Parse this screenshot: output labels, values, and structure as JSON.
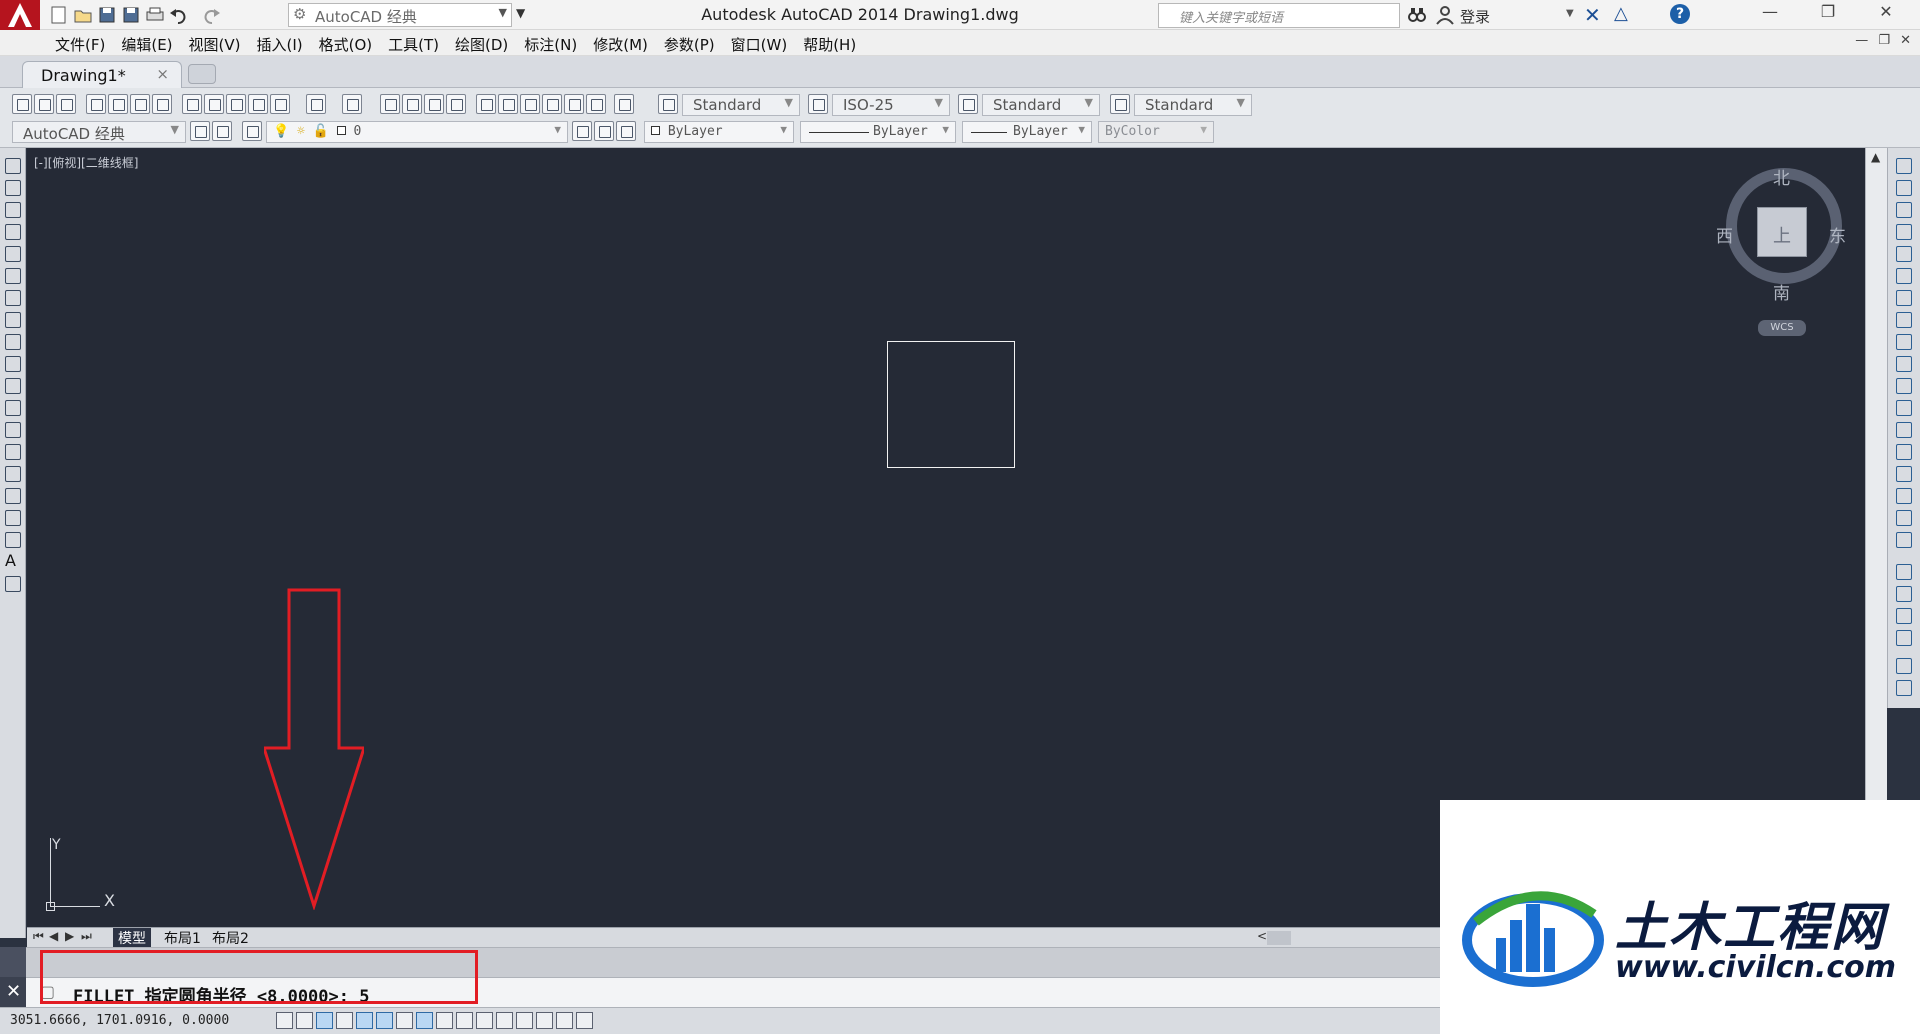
{
  "titlebar": {
    "workspace": "AutoCAD 经典",
    "title": "Autodesk AutoCAD 2014    Drawing1.dwg",
    "search_placeholder": "键入关键字或短语",
    "login": "登录"
  },
  "menubar": {
    "items": [
      "文件(F)",
      "编辑(E)",
      "视图(V)",
      "插入(I)",
      "格式(O)",
      "工具(T)",
      "绘图(D)",
      "标注(N)",
      "修改(M)",
      "参数(P)",
      "窗口(W)",
      "帮助(H)"
    ]
  },
  "tabs": {
    "document": "Drawing1*",
    "close_glyph": "×"
  },
  "toolbars": {
    "text_style": "Standard",
    "dim_style": "ISO-25",
    "table_style": "Standard",
    "multileader_style": "Standard",
    "workspace": "AutoCAD 经典",
    "layer": "0",
    "color": "ByLayer",
    "linetype": "ByLayer",
    "lineweight": "ByLayer",
    "plotstyle": "ByColor"
  },
  "canvas": {
    "viewport_label": "[-][俯视][二维线框]",
    "compass": {
      "north": "北",
      "south": "南",
      "east": "东",
      "west": "西"
    },
    "wcs": "WCS",
    "ucs_y": "Y",
    "ucs_x": "X"
  },
  "layout_tabs": [
    "模型",
    "布局1",
    "布局2"
  ],
  "command": {
    "prompt_text": "FILLET 指定圆角半径 <8.0000>: 5"
  },
  "status": {
    "coordinates": "3051.6666, 1701.0916, 0.0000"
  },
  "watermark": {
    "brand": "土木工程网",
    "url": "www.civilcn.com"
  },
  "colors": {
    "canvas_bg": "#252a36",
    "highlight_red": "#e21d24",
    "brand_blue": "#1b6fd1",
    "brand_green": "#3aa53a"
  }
}
